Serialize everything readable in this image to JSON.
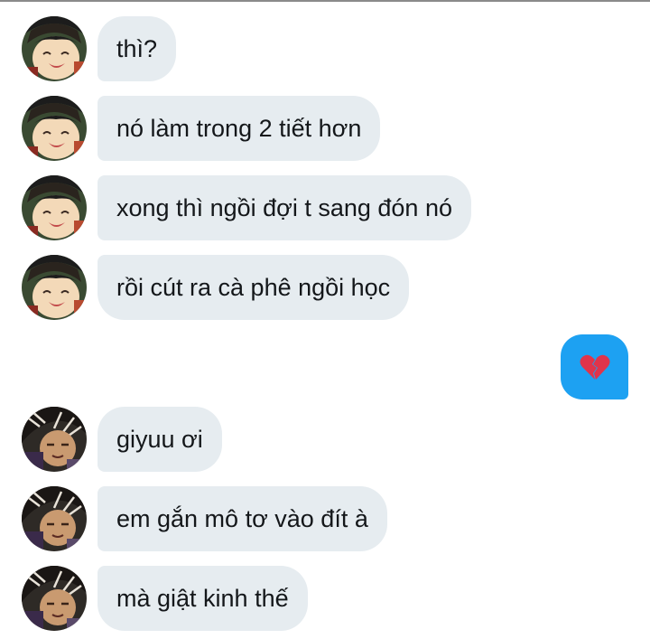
{
  "conversation": {
    "messages": [
      {
        "sender": "other",
        "avatar": "avatar-a",
        "text": "thì?"
      },
      {
        "sender": "other",
        "avatar": "avatar-a",
        "text": "nó làm trong 2 tiết hơn"
      },
      {
        "sender": "other",
        "avatar": "avatar-a",
        "text": "xong thì ngồi đợi t sang đón nó"
      },
      {
        "sender": "other",
        "avatar": "avatar-a",
        "text": "rồi cút ra cà phê ngồi học"
      },
      {
        "sender": "me",
        "icon": "broken-heart-icon"
      },
      {
        "sender": "other",
        "avatar": "avatar-b",
        "text": "giyuu ơi"
      },
      {
        "sender": "other",
        "avatar": "avatar-b",
        "text": "em gắn mô tơ vào đít à"
      },
      {
        "sender": "other",
        "avatar": "avatar-b",
        "text": "mà giật kinh thế"
      }
    ]
  },
  "colors": {
    "received_bubble": "#e6ecf0",
    "sent_bubble": "#1da1f2",
    "text": "#14171a",
    "heart": "#e0344b"
  }
}
